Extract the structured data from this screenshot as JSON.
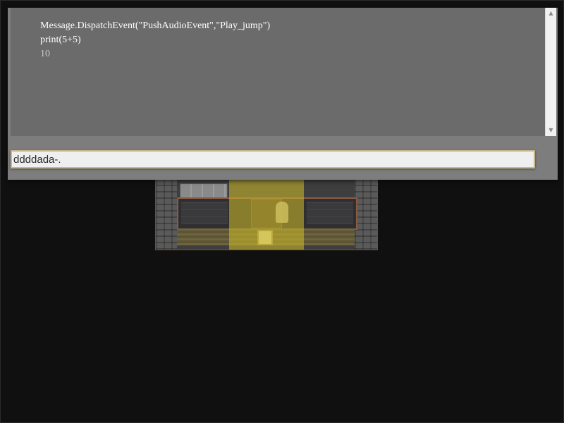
{
  "console": {
    "output_lines": [
      {
        "text": "Message.DispatchEvent(\"PushAudioEvent\",\"Play_jump\")",
        "kind": "command"
      },
      {
        "text": "print(5+5)",
        "kind": "command"
      },
      {
        "text": "10",
        "kind": "result"
      }
    ],
    "input_value": "ddddada-."
  },
  "icons": {
    "scroll_up": "scroll-up-arrow-icon",
    "scroll_down": "scroll-down-arrow-icon"
  },
  "colors": {
    "highlight": "#d2be28",
    "console_bg": "#6b6b6b",
    "input_border": "#c9b88a"
  }
}
